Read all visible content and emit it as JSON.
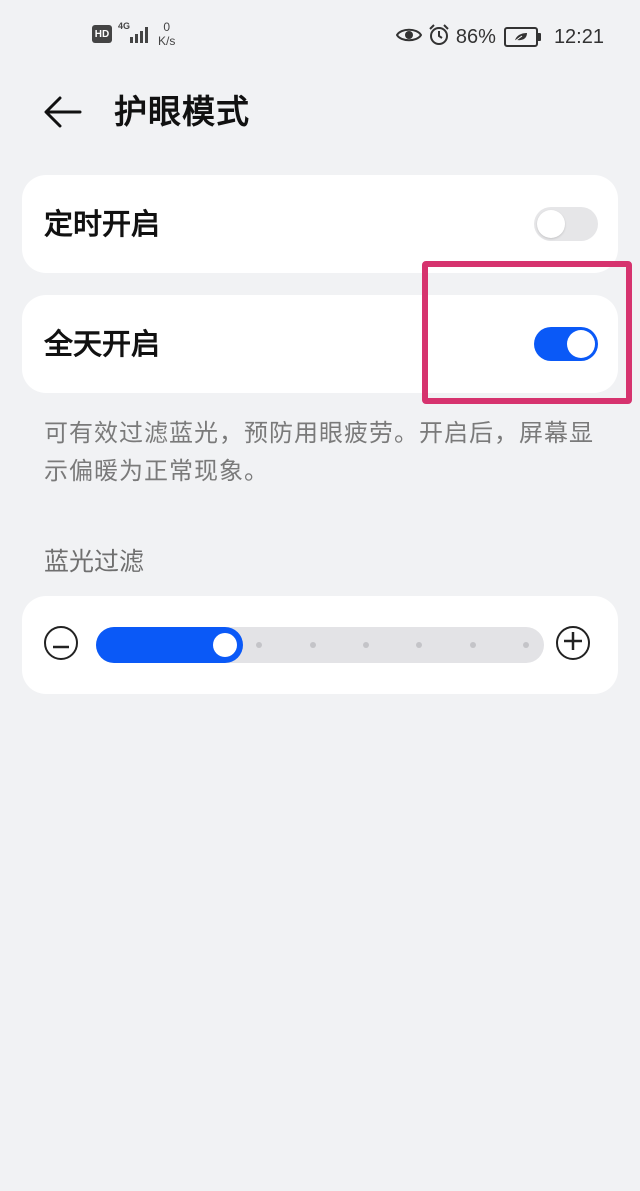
{
  "status_bar": {
    "hd": "HD",
    "network": "4G",
    "speed_value": "0",
    "speed_unit": "K/s",
    "battery": "86%",
    "time": "12:21"
  },
  "header": {
    "title": "护眼模式",
    "back_icon": "back-arrow-icon"
  },
  "schedule": {
    "label": "定时开启",
    "enabled": false
  },
  "all_day": {
    "label": "全天开启",
    "enabled": true
  },
  "description": "可有效过滤蓝光，预防用眼疲劳。开启后，屏幕显示偏暖为正常现象。",
  "blue_light_filter": {
    "label": "蓝光过滤",
    "level": 0.27,
    "ticks": 6
  },
  "colors": {
    "accent": "#0a59f7",
    "highlight": "#d6336e",
    "background": "#f1f2f4"
  }
}
